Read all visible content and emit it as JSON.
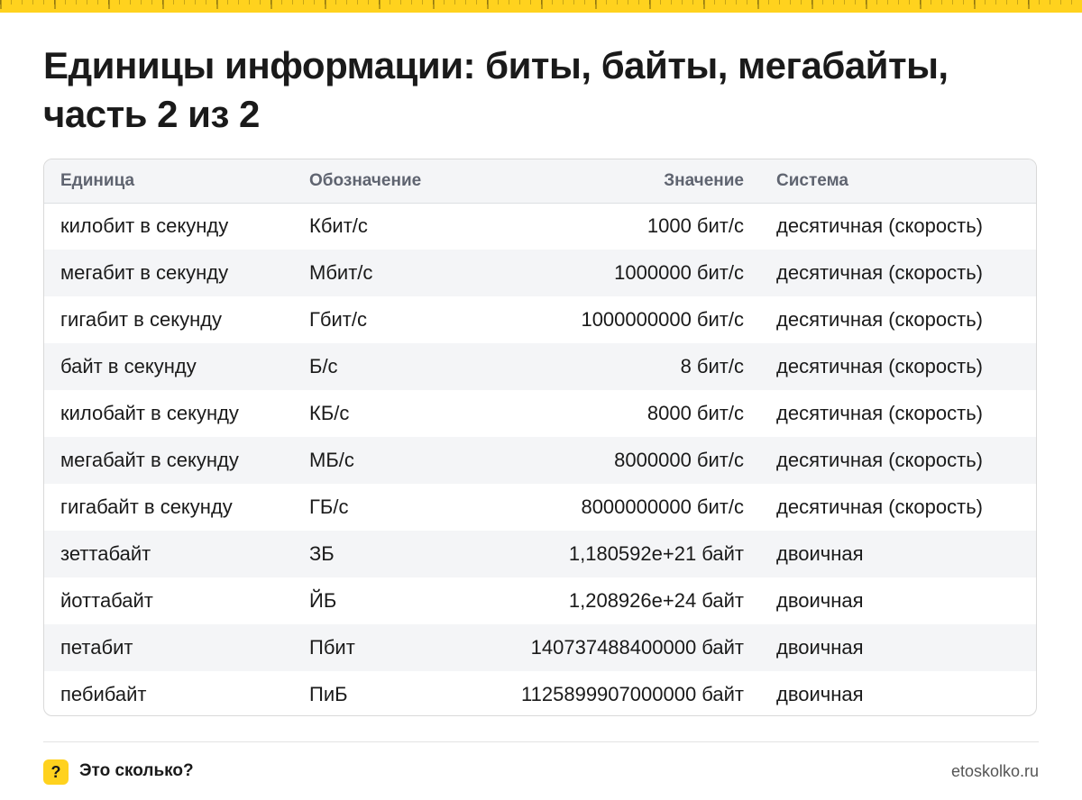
{
  "title": "Единицы информации: биты, байты, мегабайты, часть 2 из 2",
  "colors": {
    "accent": "#ffd21e",
    "stripe": "#f4f5f7",
    "header_text": "#5f6470",
    "text": "#1a1a1a"
  },
  "table": {
    "headers": [
      "Единица",
      "Обозначение",
      "Значение",
      "Система"
    ],
    "rows": [
      [
        "килобит в секунду",
        "Кбит/с",
        "1000 бит/с",
        "десятичная (скорость)"
      ],
      [
        "мегабит в секунду",
        "Мбит/с",
        "1000000 бит/с",
        "десятичная (скорость)"
      ],
      [
        "гигабит в секунду",
        "Гбит/с",
        "1000000000 бит/с",
        "десятичная (скорость)"
      ],
      [
        "байт в секунду",
        "Б/с",
        "8 бит/с",
        "десятичная (скорость)"
      ],
      [
        "килобайт в секунду",
        "КБ/с",
        "8000 бит/с",
        "десятичная (скорость)"
      ],
      [
        "мегабайт в секунду",
        "МБ/с",
        "8000000 бит/с",
        "десятичная (скорость)"
      ],
      [
        "гигабайт в секунду",
        "ГБ/с",
        "8000000000 бит/с",
        "десятичная (скорость)"
      ],
      [
        "зеттабайт",
        "ЗБ",
        "1,180592e+21 байт",
        "двоичная"
      ],
      [
        "йоттабайт",
        "ЙБ",
        "1,208926e+24 байт",
        "двоичная"
      ],
      [
        "петабит",
        "Пбит",
        "140737488400000 байт",
        "двоичная"
      ],
      [
        "пебибайт",
        "ПиБ",
        "1125899907000000 байт",
        "двоичная"
      ]
    ]
  },
  "footer": {
    "badge": "?",
    "brand": "Это сколько?",
    "site": "etoskolko.ru"
  }
}
